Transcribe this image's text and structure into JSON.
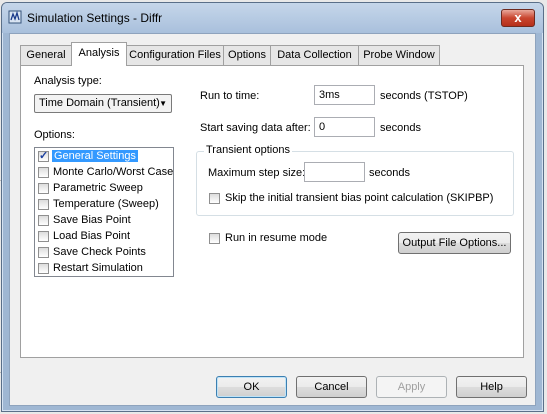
{
  "window": {
    "title": "Simulation Settings - Diffr",
    "close_glyph": "x"
  },
  "tabs": [
    {
      "label": "General"
    },
    {
      "label": "Analysis",
      "active": true
    },
    {
      "label": "Configuration Files"
    },
    {
      "label": "Options"
    },
    {
      "label": "Data Collection"
    },
    {
      "label": "Probe Window"
    }
  ],
  "analysis": {
    "type_label": "Analysis type:",
    "type_value": "Time Domain (Transient)",
    "options_label": "Options:",
    "options": [
      {
        "label": "General Settings",
        "checked": true,
        "selected": true
      },
      {
        "label": "Monte Carlo/Worst Case",
        "checked": false
      },
      {
        "label": "Parametric Sweep",
        "checked": false
      },
      {
        "label": "Temperature (Sweep)",
        "checked": false
      },
      {
        "label": "Save Bias Point",
        "checked": false
      },
      {
        "label": "Load Bias Point",
        "checked": false
      },
      {
        "label": "Save Check Points",
        "checked": false
      },
      {
        "label": "Restart Simulation",
        "checked": false
      }
    ],
    "run_to_time_label": "Run to time:",
    "run_to_time_value": "3ms",
    "run_to_time_unit": "seconds  (TSTOP)",
    "start_saving_label": "Start saving data after:",
    "start_saving_value": "0",
    "start_saving_unit": "seconds",
    "transient_group_title": "Transient options",
    "max_step_label": "Maximum step size:",
    "max_step_value": "",
    "max_step_unit": "seconds",
    "skip_bias_label": "Skip the initial transient bias point calculation  (SKIPBP)",
    "skip_bias_checked": false,
    "resume_label": "Run in resume mode",
    "resume_checked": false,
    "output_options_label": "Output File Options..."
  },
  "buttons": {
    "ok": "OK",
    "cancel": "Cancel",
    "apply": "Apply",
    "help": "Help"
  }
}
